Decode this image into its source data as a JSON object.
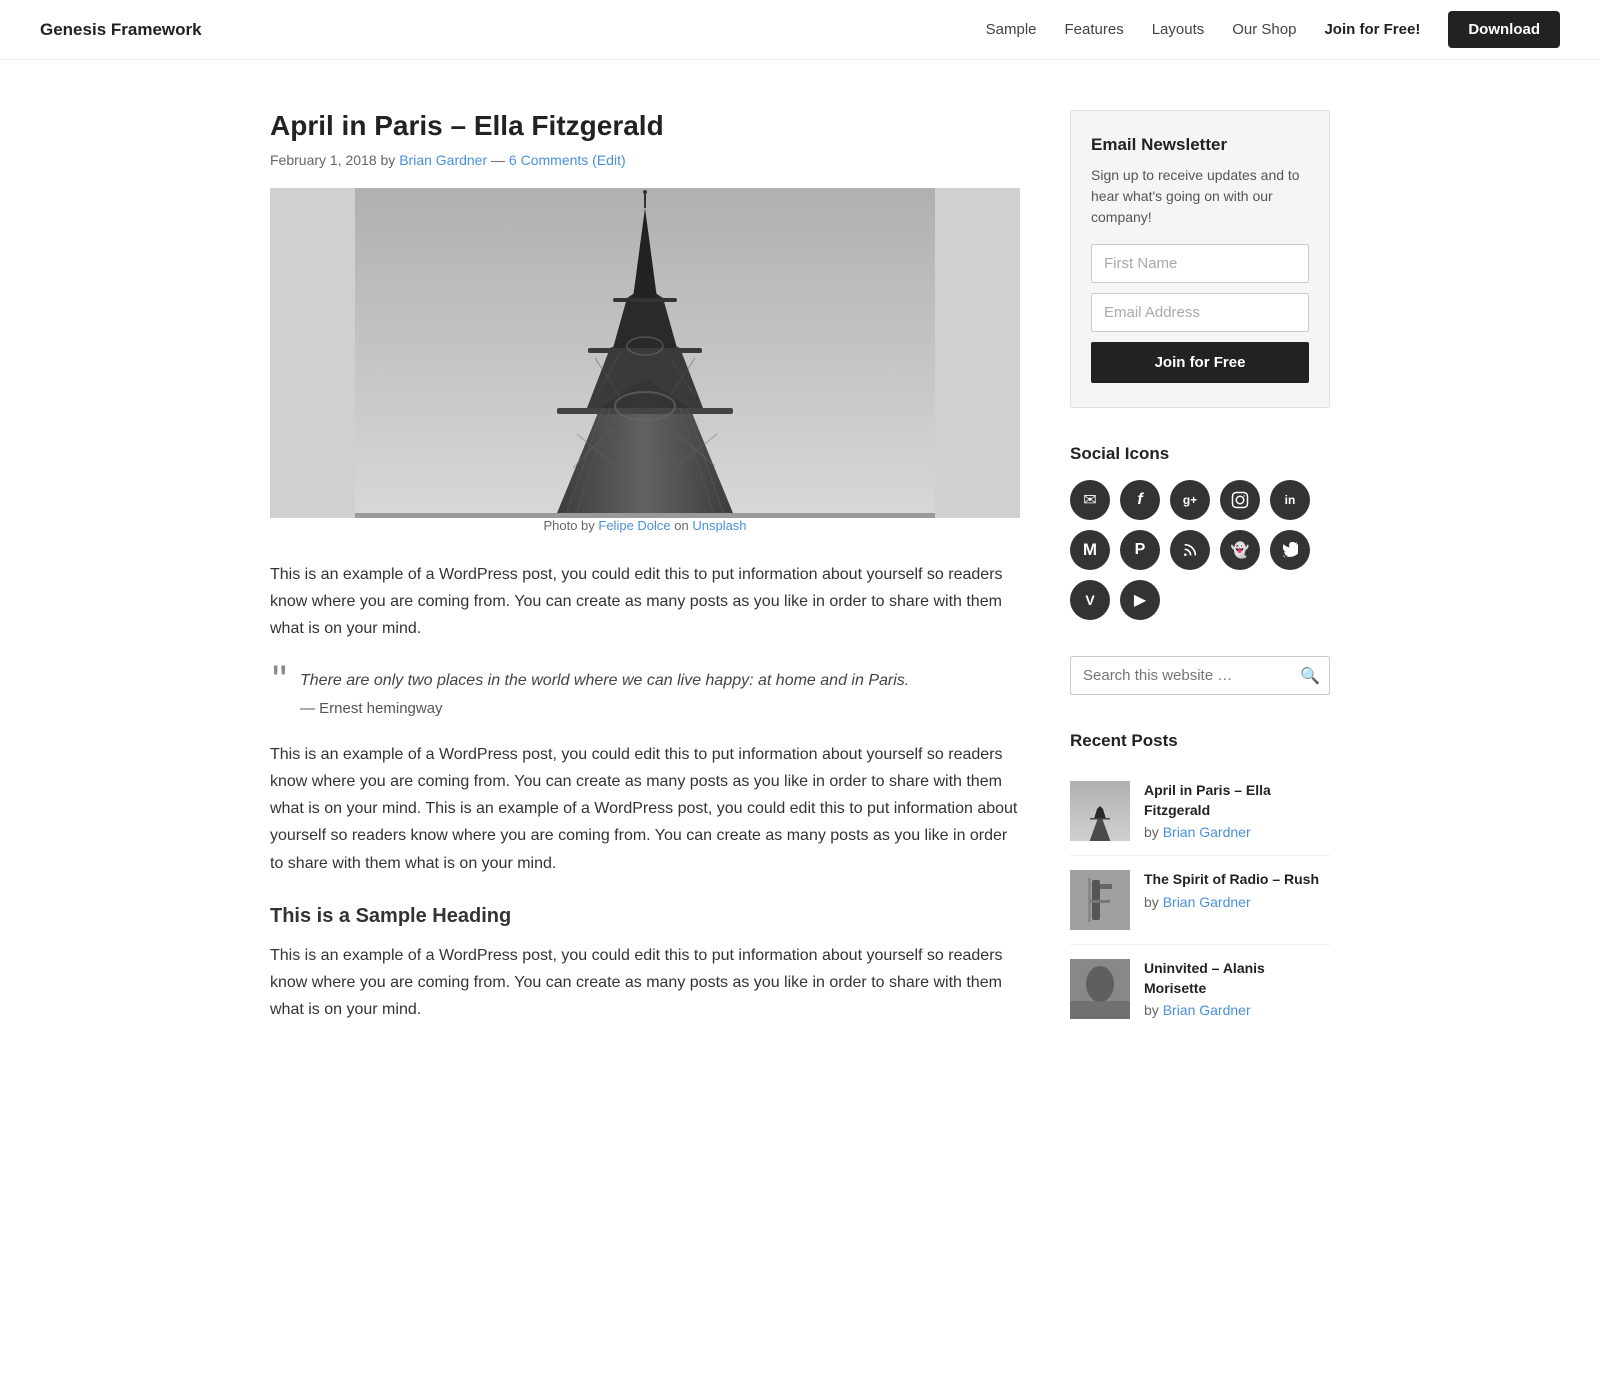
{
  "nav": {
    "logo": "Genesis Framework",
    "links": [
      {
        "label": "Sample",
        "href": "#"
      },
      {
        "label": "Features",
        "href": "#"
      },
      {
        "label": "Layouts",
        "href": "#"
      },
      {
        "label": "Our Shop",
        "href": "#"
      }
    ],
    "join_label": "Join for Free!",
    "download_label": "Download"
  },
  "post": {
    "title": "April in Paris – Ella Fitzgerald",
    "date": "February 1, 2018",
    "author": "Brian Gardner",
    "comments": "6 Comments",
    "edit_label": "(Edit)",
    "photo_credit_prefix": "Photo by ",
    "photo_credit_name": "Felipe Dolce",
    "photo_credit_on": " on ",
    "photo_credit_source": "Unsplash",
    "body1": "This is an example of a WordPress post, you could edit this to put information about yourself so readers know where you are coming from. You can create as many posts as you like in order to share with them what is on your mind.",
    "blockquote_text": "There are only two places in the world where we can live happy: at home and in Paris.",
    "blockquote_attribution": "— Ernest hemingway",
    "body2": "This is an example of a WordPress post, you could edit this to put information about yourself so readers know where you are coming from. You can create as many posts as you like in order to share with them what is on your mind. This is an example of a WordPress post, you could edit this to put information about yourself so readers know where you are coming from. You can create as many posts as you like in order to share with them what is on your mind.",
    "section_heading": "This is a Sample Heading",
    "body3": "This is an example of a WordPress post, you could edit this to put information about yourself so readers know where you are coming from. You can create as many posts as you like in order to share with them what is on your mind."
  },
  "sidebar": {
    "newsletter": {
      "title": "Email Newsletter",
      "description": "Sign up to receive updates and to hear what's going on with our company!",
      "first_name_placeholder": "First Name",
      "email_placeholder": "Email Address",
      "button_label": "Join for Free"
    },
    "social": {
      "title": "Social Icons",
      "icons": [
        {
          "name": "email-icon",
          "symbol": "✉"
        },
        {
          "name": "facebook-icon",
          "symbol": "f"
        },
        {
          "name": "google-plus-icon",
          "symbol": "g+"
        },
        {
          "name": "instagram-icon",
          "symbol": "📷"
        },
        {
          "name": "linkedin-icon",
          "symbol": "in"
        },
        {
          "name": "medium-icon",
          "symbol": "M"
        },
        {
          "name": "pinterest-icon",
          "symbol": "P"
        },
        {
          "name": "rss-icon",
          "symbol": "⌘"
        },
        {
          "name": "snapchat-icon",
          "symbol": "👻"
        },
        {
          "name": "twitter-icon",
          "symbol": "t"
        },
        {
          "name": "vimeo-icon",
          "symbol": "V"
        },
        {
          "name": "youtube-icon",
          "symbol": "▶"
        }
      ]
    },
    "search": {
      "placeholder": "Search this website …"
    },
    "recent_posts": {
      "title": "Recent Posts",
      "posts": [
        {
          "title": "April in Paris – Ella Fitzgerald",
          "author": "Brian Gardner"
        },
        {
          "title": "The Spirit of Radio – Rush",
          "author": "Brian Gardner"
        },
        {
          "title": "Uninvited – Alanis Morisette",
          "author": "Brian Gardner"
        }
      ]
    }
  }
}
